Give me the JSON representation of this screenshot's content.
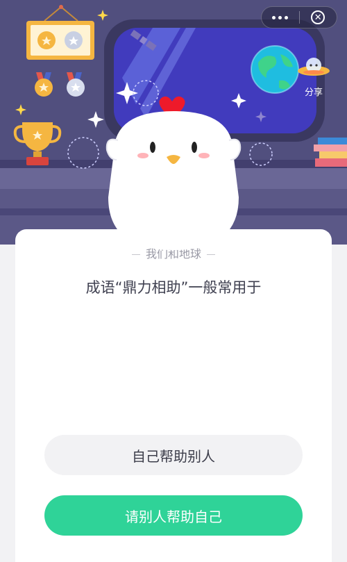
{
  "capsule": {
    "more_icon": "more-dots-icon",
    "close_icon": "close-circle-icon"
  },
  "share": {
    "label": "分享",
    "icon": "flying-saucer-icon"
  },
  "quiz": {
    "category": "我们和地球",
    "question": "成语“鼎力相助”一般常用于",
    "options": [
      "自己帮助别人",
      "请别人帮助自己"
    ]
  },
  "colors": {
    "accent": "#2fd398",
    "scene": "#514f7e",
    "card": "#ffffff"
  }
}
